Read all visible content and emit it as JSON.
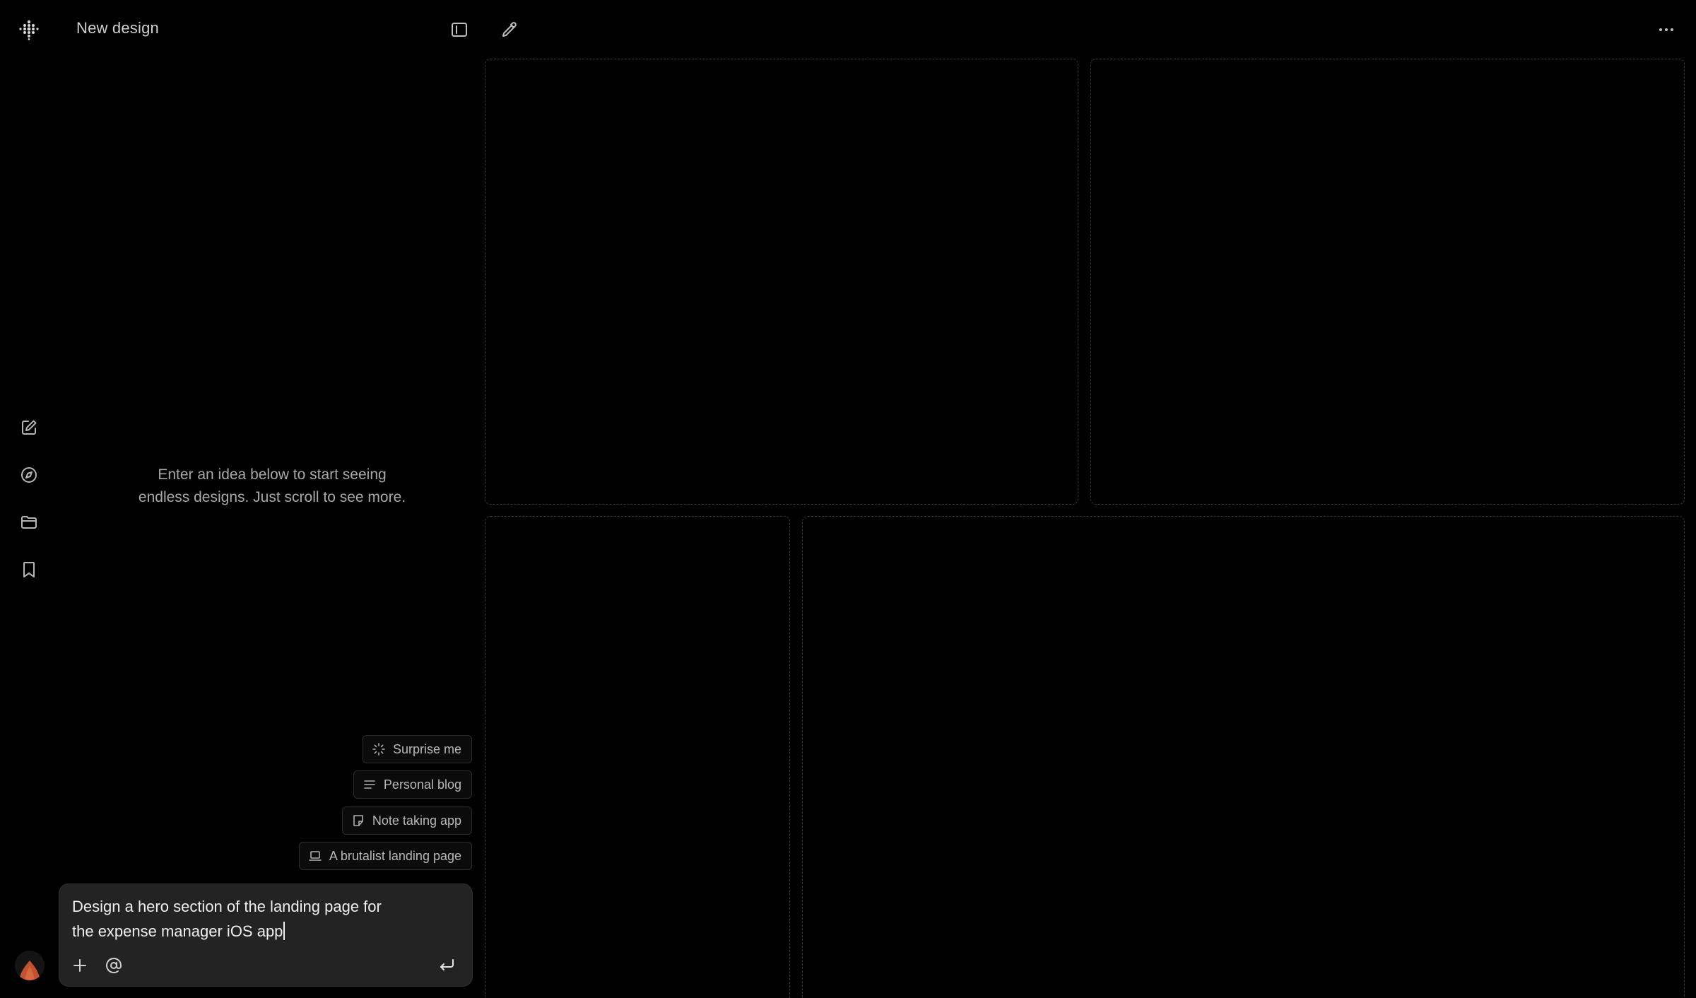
{
  "header": {
    "title": "New design"
  },
  "empty_state": {
    "line1": "Enter an idea below to start seeing",
    "line2": "endless designs. Just scroll to see more."
  },
  "suggestions": [
    {
      "label": "Surprise me",
      "icon": "sparkle-icon"
    },
    {
      "label": "Personal blog",
      "icon": "lines-icon"
    },
    {
      "label": "Note taking app",
      "icon": "note-icon"
    },
    {
      "label": "A brutalist landing page",
      "icon": "laptop-icon"
    }
  ],
  "composer": {
    "line1": "Design a hero section of the landing page for",
    "line2": "the expense manager iOS app"
  },
  "colors": {
    "background": "#000000",
    "composer": "#232323",
    "frame_border": "#3a3a3a",
    "avatar": "#c2522f"
  }
}
